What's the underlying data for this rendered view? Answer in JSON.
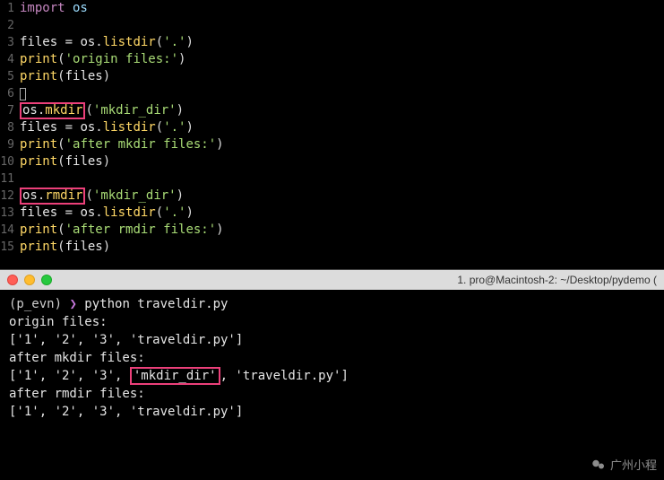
{
  "editor": {
    "lines": [
      {
        "n": "1",
        "tokens": [
          [
            "kw-import",
            "import"
          ],
          [
            "",
            ""
          ],
          [
            "mod",
            " os"
          ]
        ]
      },
      {
        "n": "2",
        "tokens": []
      },
      {
        "n": "3",
        "tokens": [
          [
            "ident",
            "files "
          ],
          [
            "punct",
            "= "
          ],
          [
            "ident",
            "os"
          ],
          [
            "punct",
            "."
          ],
          [
            "func",
            "listdir"
          ],
          [
            "punct",
            "("
          ],
          [
            "str",
            "'.'"
          ],
          [
            "punct",
            ")"
          ]
        ]
      },
      {
        "n": "4",
        "tokens": [
          [
            "func",
            "print"
          ],
          [
            "punct",
            "("
          ],
          [
            "str",
            "'origin files:'"
          ],
          [
            "punct",
            ")"
          ]
        ]
      },
      {
        "n": "5",
        "tokens": [
          [
            "func",
            "print"
          ],
          [
            "punct",
            "("
          ],
          [
            "ident",
            "files"
          ],
          [
            "punct",
            ")"
          ]
        ]
      },
      {
        "n": "6",
        "tokens": [
          [
            "cursor",
            ""
          ]
        ]
      },
      {
        "n": "7",
        "tokens": [
          [
            "boxed",
            "os.mkdir"
          ],
          [
            "punct",
            "("
          ],
          [
            "str",
            "'mkdir_dir'"
          ],
          [
            "punct",
            ")"
          ]
        ]
      },
      {
        "n": "8",
        "tokens": [
          [
            "ident",
            "files "
          ],
          [
            "punct",
            "= "
          ],
          [
            "ident",
            "os"
          ],
          [
            "punct",
            "."
          ],
          [
            "func",
            "listdir"
          ],
          [
            "punct",
            "("
          ],
          [
            "str",
            "'.'"
          ],
          [
            "punct",
            ")"
          ]
        ]
      },
      {
        "n": "9",
        "tokens": [
          [
            "func",
            "print"
          ],
          [
            "punct",
            "("
          ],
          [
            "str",
            "'after mkdir files:'"
          ],
          [
            "punct",
            ")"
          ]
        ]
      },
      {
        "n": "10",
        "tokens": [
          [
            "func",
            "print"
          ],
          [
            "punct",
            "("
          ],
          [
            "ident",
            "files"
          ],
          [
            "punct",
            ")"
          ]
        ]
      },
      {
        "n": "11",
        "tokens": []
      },
      {
        "n": "12",
        "tokens": [
          [
            "boxed",
            "os.rmdir"
          ],
          [
            "punct",
            "("
          ],
          [
            "str",
            "'mkdir_dir'"
          ],
          [
            "punct",
            ")"
          ]
        ]
      },
      {
        "n": "13",
        "tokens": [
          [
            "ident",
            "files "
          ],
          [
            "punct",
            "= "
          ],
          [
            "ident",
            "os"
          ],
          [
            "punct",
            "."
          ],
          [
            "func",
            "listdir"
          ],
          [
            "punct",
            "("
          ],
          [
            "str",
            "'.'"
          ],
          [
            "punct",
            ")"
          ]
        ]
      },
      {
        "n": "14",
        "tokens": [
          [
            "func",
            "print"
          ],
          [
            "punct",
            "("
          ],
          [
            "str",
            "'after rmdir files:'"
          ],
          [
            "punct",
            ")"
          ]
        ]
      },
      {
        "n": "15",
        "tokens": [
          [
            "func",
            "print"
          ],
          [
            "punct",
            "("
          ],
          [
            "ident",
            "files"
          ],
          [
            "punct",
            ")"
          ]
        ]
      }
    ]
  },
  "terminal": {
    "title": "1. pro@Macintosh-2: ~/Desktop/pydemo (",
    "prompt_env": "(p_evn)",
    "prompt_sym": "❯",
    "command": "python traveldir.py",
    "output": [
      {
        "segments": [
          [
            "",
            "origin files:"
          ]
        ]
      },
      {
        "segments": [
          [
            "",
            "['1', '2', '3', 'traveldir.py']"
          ]
        ]
      },
      {
        "segments": [
          [
            "",
            "after mkdir files:"
          ]
        ]
      },
      {
        "segments": [
          [
            "",
            "['1', '2', '3', "
          ],
          [
            "box",
            "'mkdir_dir'"
          ],
          [
            "",
            ", 'traveldir.py']"
          ]
        ]
      },
      {
        "segments": [
          [
            "",
            "after rmdir files:"
          ]
        ]
      },
      {
        "segments": [
          [
            "",
            "['1', '2', '3', 'traveldir.py']"
          ]
        ]
      }
    ]
  },
  "watermark": "广州小程"
}
